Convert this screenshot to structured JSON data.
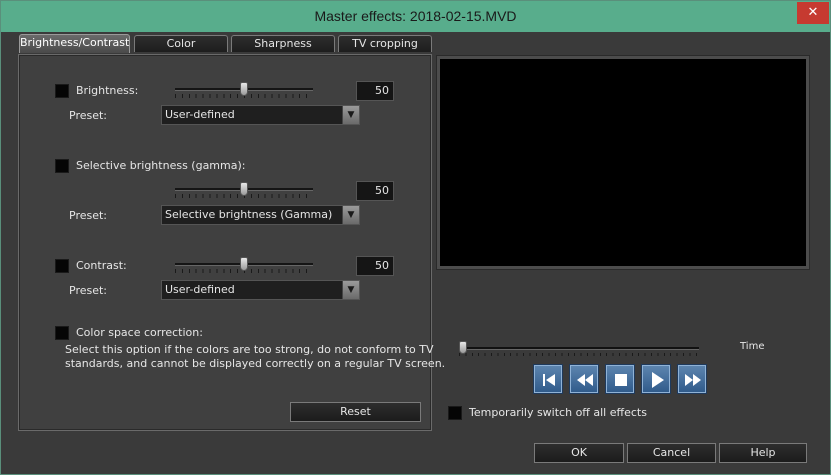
{
  "window": {
    "title": "Master effects: 2018-02-15.MVD",
    "close_glyph": "✕",
    "titlebar_color": "#58ad8c",
    "close_color": "#c63a30"
  },
  "tabs": [
    {
      "label": "Brightness/Contrast",
      "active": true
    },
    {
      "label": "Color",
      "active": false
    },
    {
      "label": "Sharpness",
      "active": false
    },
    {
      "label": "TV cropping",
      "active": false
    }
  ],
  "brightness": {
    "label": "Brightness:",
    "checked": false,
    "value": "50",
    "slider_fraction": 0.5,
    "preset_label": "Preset:",
    "preset_value": "User-defined"
  },
  "gamma": {
    "label": "Selective brightness (gamma):",
    "checked": false,
    "value": "50",
    "slider_fraction": 0.5,
    "preset_label": "Preset:",
    "preset_value": "Selective brightness (Gamma)"
  },
  "contrast": {
    "label": "Contrast:",
    "checked": false,
    "value": "50",
    "slider_fraction": 0.5,
    "preset_label": "Preset:",
    "preset_value": "User-defined"
  },
  "color_space": {
    "label": "Color space correction:",
    "checked": false,
    "description_line1": "Select this option if the colors are too strong, do not conform to TV",
    "description_line2": "standards, and cannot be displayed correctly on a regular TV screen."
  },
  "reset_label": "Reset",
  "time_label": "Time",
  "time_slider_fraction": 0.0,
  "transport": {
    "icons": [
      "skip-to-start-icon",
      "rewind-icon",
      "stop-icon",
      "play-icon",
      "fast-forward-icon"
    ],
    "button_color": "#3f6c9c"
  },
  "switch_off": {
    "label": "Temporarily switch off all effects",
    "checked": false
  },
  "footer": {
    "ok_label": "OK",
    "cancel_label": "Cancel",
    "help_label": "Help"
  }
}
